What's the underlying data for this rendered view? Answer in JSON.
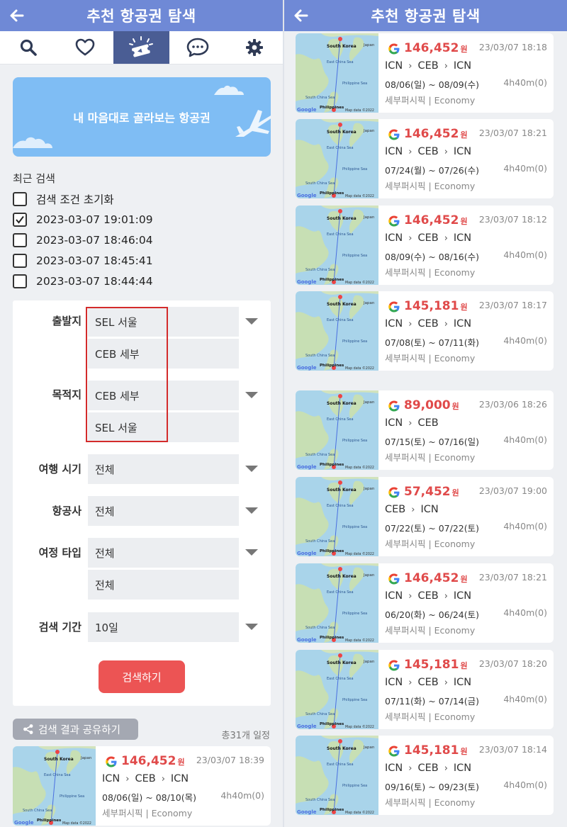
{
  "header": {
    "title": "추천 항공권 탐색"
  },
  "tabs": [
    {
      "icon": "search-icon"
    },
    {
      "icon": "heart-icon"
    },
    {
      "icon": "ticket-icon",
      "active": true
    },
    {
      "icon": "chat-icon"
    },
    {
      "icon": "gear-icon"
    }
  ],
  "banner": {
    "text": "내 마음대로 골라보는 항공권"
  },
  "recent": {
    "title": "최근 검색",
    "items": [
      {
        "label": "검색 조건 초기화",
        "checked": false
      },
      {
        "label": "2023-03-07 19:01:09",
        "checked": true
      },
      {
        "label": "2023-03-07 18:46:04",
        "checked": false
      },
      {
        "label": "2023-03-07 18:45:41",
        "checked": false
      },
      {
        "label": "2023-03-07 18:44:44",
        "checked": false
      }
    ]
  },
  "form": {
    "departure": {
      "label": "출발지",
      "values": [
        "SEL 서울",
        "CEB 세부"
      ]
    },
    "destination": {
      "label": "목적지",
      "values": [
        "CEB 세부",
        "SEL 서울"
      ]
    },
    "travel_time": {
      "label": "여행 시기",
      "value": "전체"
    },
    "airline": {
      "label": "항공사",
      "value": "전체"
    },
    "trip_type": {
      "label": "여정 타입",
      "values": [
        "전체",
        "전체"
      ]
    },
    "period": {
      "label": "검색 기간",
      "value": "10일"
    },
    "search_button": "검색하기"
  },
  "share": {
    "label": "검색 결과 공유하기",
    "total": "총31개 일정"
  },
  "map_labels": {
    "country1": "South Korea",
    "country2": "Japan",
    "sea1": "East China Sea",
    "sea2": "Philippine Sea",
    "sea3": "South China Sea",
    "country3": "Philippines",
    "credit": "Map data ©2022",
    "brand": "Google"
  },
  "currency": "원",
  "left_results": [
    {
      "price": "146,452",
      "timestamp": "23/03/07 18:39",
      "route": [
        "ICN",
        "CEB",
        "ICN"
      ],
      "dates": "08/06(일) ~ 08/10(목)",
      "duration": "4h40m(0)",
      "airline": "세부퍼시픽 | Economy"
    }
  ],
  "right_results": [
    {
      "price": "146,452",
      "timestamp": "23/03/07 18:18",
      "route": [
        "ICN",
        "CEB",
        "ICN"
      ],
      "dates": "08/06(일) ~ 08/09(수)",
      "duration": "4h40m(0)",
      "airline": "세부퍼시픽 | Economy"
    },
    {
      "price": "146,452",
      "timestamp": "23/03/07 18:21",
      "route": [
        "ICN",
        "CEB",
        "ICN"
      ],
      "dates": "07/24(월) ~ 07/26(수)",
      "duration": "4h40m(0)",
      "airline": "세부퍼시픽 | Economy"
    },
    {
      "price": "146,452",
      "timestamp": "23/03/07 18:12",
      "route": [
        "ICN",
        "CEB",
        "ICN"
      ],
      "dates": "08/09(수) ~ 08/16(수)",
      "duration": "4h40m(0)",
      "airline": "세부퍼시픽 | Economy"
    },
    {
      "price": "145,181",
      "timestamp": "23/03/07 18:17",
      "route": [
        "ICN",
        "CEB",
        "ICN"
      ],
      "dates": "07/08(토) ~ 07/11(화)",
      "duration": "4h40m(0)",
      "airline": "세부퍼시픽 | Economy"
    },
    {
      "price": "89,000",
      "timestamp": "23/03/06 18:26",
      "route": [
        "ICN",
        "CEB"
      ],
      "dates": "07/15(토) ~ 07/16(일)",
      "duration": "4h40m(0)",
      "airline": "세부퍼시픽 | Economy"
    },
    {
      "price": "57,452",
      "timestamp": "23/03/07 19:00",
      "route": [
        "CEB",
        "ICN"
      ],
      "dates": "07/22(토) ~ 07/22(토)",
      "duration": "4h40m(0)",
      "airline": "세부퍼시픽 | Economy"
    },
    {
      "price": "146,452",
      "timestamp": "23/03/07 18:21",
      "route": [
        "ICN",
        "CEB",
        "ICN"
      ],
      "dates": "06/20(화) ~ 06/24(토)",
      "duration": "4h40m(0)",
      "airline": "세부퍼시픽 | Economy"
    },
    {
      "price": "145,181",
      "timestamp": "23/03/07 18:20",
      "route": [
        "ICN",
        "CEB",
        "ICN"
      ],
      "dates": "07/11(화) ~ 07/14(금)",
      "duration": "4h40m(0)",
      "airline": "세부퍼시픽 | Economy"
    },
    {
      "price": "145,181",
      "timestamp": "23/03/07 18:14",
      "route": [
        "ICN",
        "CEB",
        "ICN"
      ],
      "dates": "09/16(토) ~ 09/23(토)",
      "duration": "4h40m(0)",
      "airline": "세부퍼시픽 | Economy"
    }
  ],
  "colors": {
    "header": "#6f89d6",
    "active_tab": "#4a5d94",
    "banner": "#7fbdf4",
    "price": "#e04a4a",
    "search_button": "#ec5454",
    "highlight_box": "#d32b2b"
  }
}
